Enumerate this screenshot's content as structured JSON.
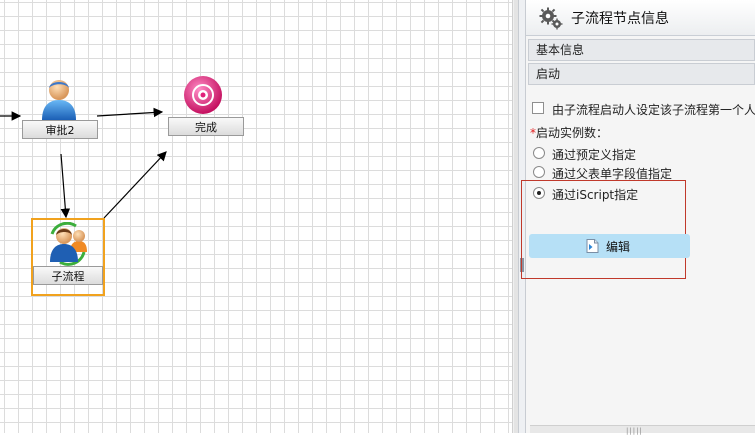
{
  "workflow": {
    "nodes": [
      {
        "id": "approve2",
        "label": "审批2"
      },
      {
        "id": "complete",
        "label": "完成"
      },
      {
        "id": "subprocess",
        "label": "子流程"
      }
    ]
  },
  "panel": {
    "title": "子流程节点信息",
    "sections": {
      "basic": "基本信息",
      "start": "启动"
    },
    "checkbox_label": "由子流程启动人设定该子流程第一个人",
    "checkbox_checked": false,
    "instances_label": "启动实例数：",
    "required_mark": "*",
    "radios": [
      {
        "label": "通过预定义指定",
        "selected": false
      },
      {
        "label": "通过父表单字段值指定",
        "selected": false
      },
      {
        "label": "通过iScript指定",
        "selected": true
      }
    ],
    "edit_button": "编辑",
    "scroll_grip": "|||||"
  },
  "colors": {
    "selection_border": "#f1a21e",
    "highlight_box": "#c0392b",
    "edit_button_bg": "#b6e0f6",
    "complete_icon": "#e0207a"
  }
}
